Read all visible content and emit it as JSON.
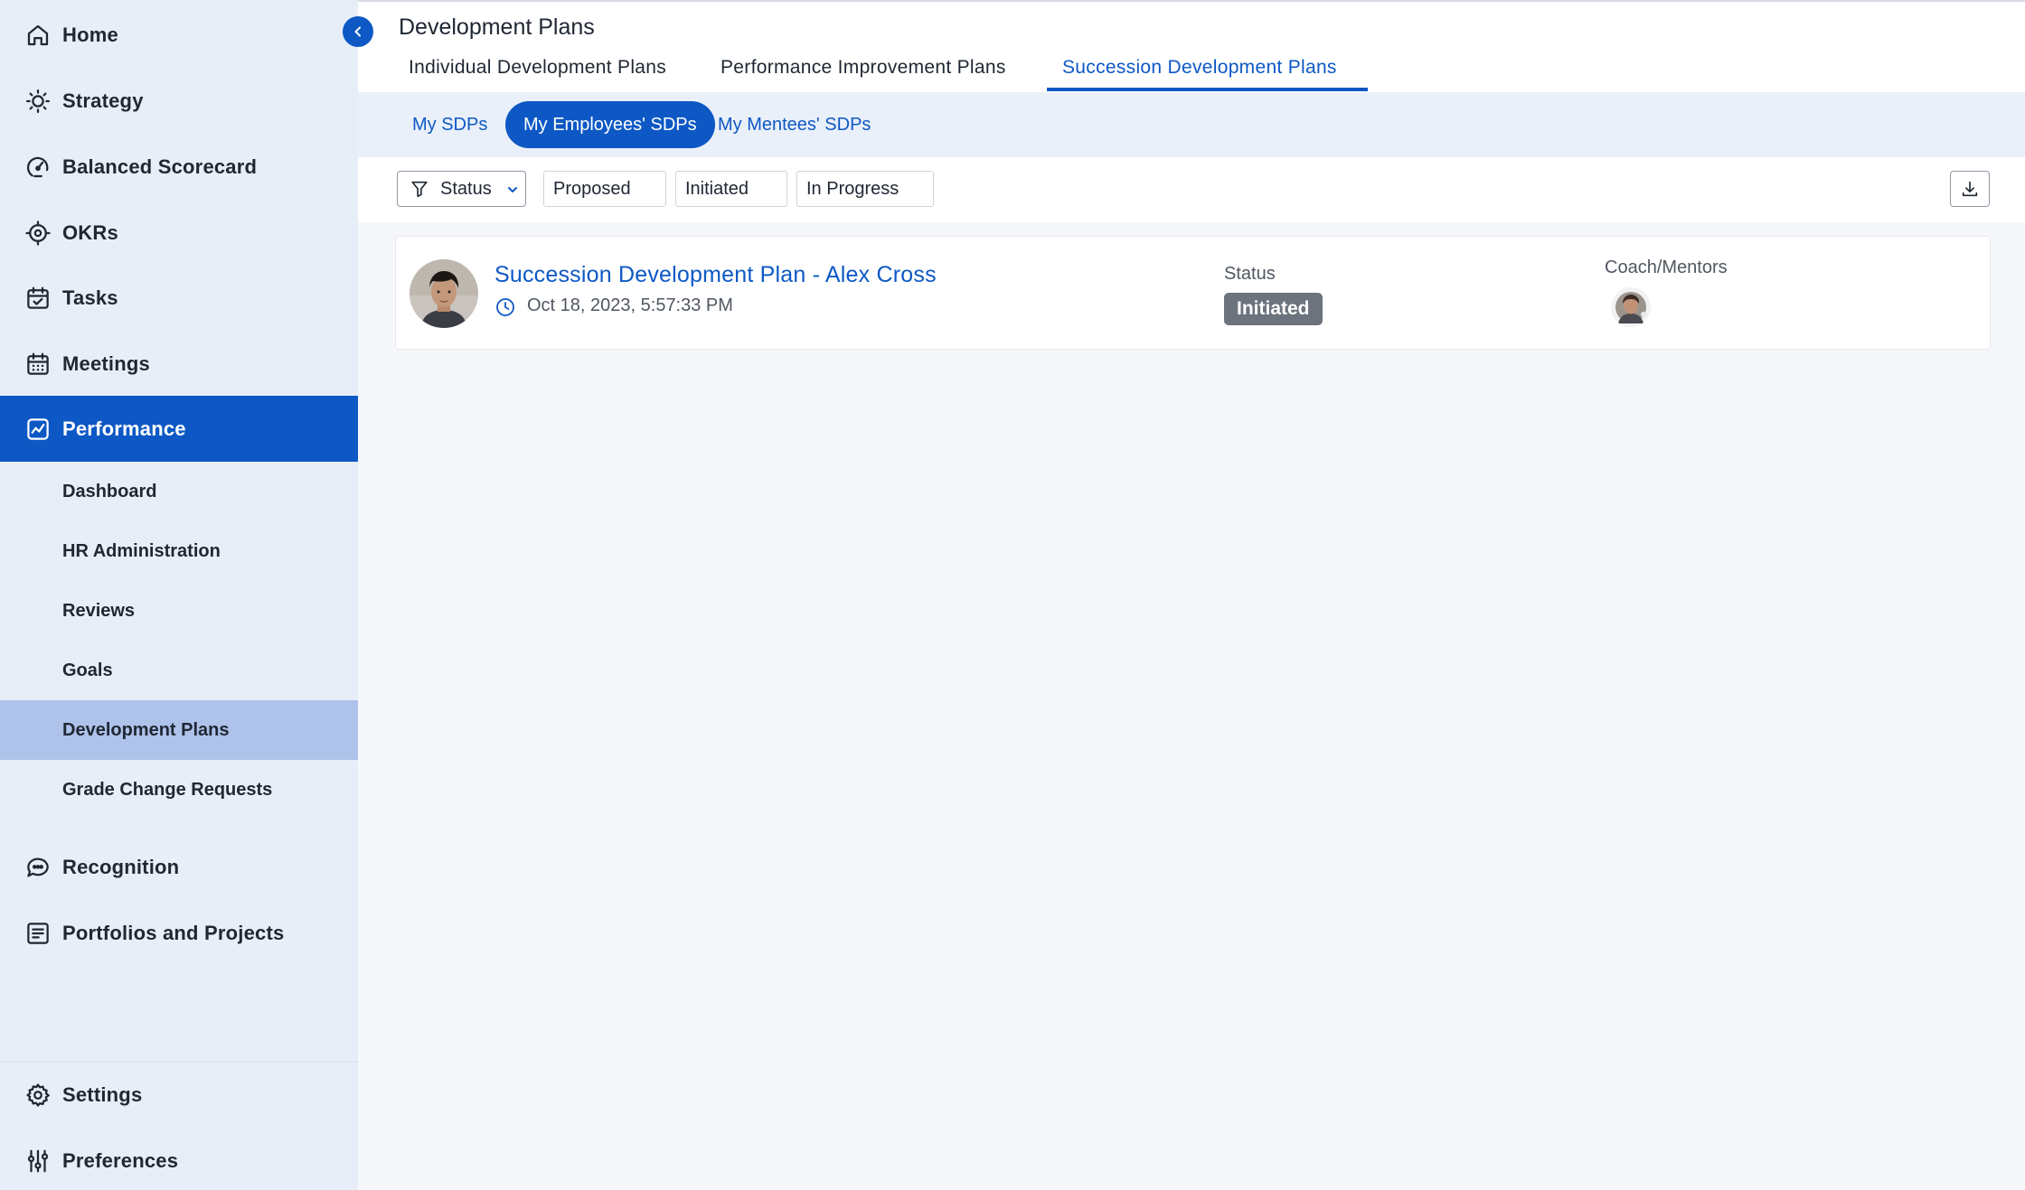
{
  "sidebar": {
    "items": [
      {
        "label": "Home",
        "icon": "home-icon"
      },
      {
        "label": "Strategy",
        "icon": "lightbulb-icon"
      },
      {
        "label": "Balanced Scorecard",
        "icon": "gauge-icon"
      },
      {
        "label": "OKRs",
        "icon": "target-icon"
      },
      {
        "label": "Tasks",
        "icon": "calendar-check-icon"
      },
      {
        "label": "Meetings",
        "icon": "calendar-grid-icon"
      },
      {
        "label": "Performance",
        "icon": "chart-line-icon",
        "active": true
      },
      {
        "label": "Recognition",
        "icon": "chat-icon"
      },
      {
        "label": "Portfolios and Projects",
        "icon": "document-list-icon"
      }
    ],
    "performance_sub": [
      {
        "label": "Dashboard"
      },
      {
        "label": "HR Administration"
      },
      {
        "label": "Reviews"
      },
      {
        "label": "Goals"
      },
      {
        "label": "Development Plans",
        "active": true
      },
      {
        "label": "Grade Change Requests"
      }
    ],
    "bottom": [
      {
        "label": "Settings",
        "icon": "gear-icon"
      },
      {
        "label": "Preferences",
        "icon": "sliders-icon"
      }
    ]
  },
  "header": {
    "title": "Development Plans",
    "tabs": [
      {
        "label": "Individual Development Plans"
      },
      {
        "label": "Performance Improvement Plans"
      },
      {
        "label": "Succession Development Plans",
        "active": true
      }
    ]
  },
  "subtabs": [
    {
      "label": "My SDPs"
    },
    {
      "label": "My Employees' SDPs",
      "active": true
    },
    {
      "label": "My Mentees' SDPs"
    }
  ],
  "filters": {
    "status_label": "Status",
    "chips": [
      "Proposed",
      "Initiated",
      "In Progress"
    ]
  },
  "plans": [
    {
      "title": "Succession Development Plan - Alex Cross",
      "timestamp": "Oct 18, 2023, 5:57:33 PM",
      "status_label": "Status",
      "status": "Initiated",
      "mentors_label": "Coach/Mentors"
    }
  ],
  "colors": {
    "primary": "#0d58c5",
    "sidebar_bg": "#e7eef8",
    "active_sub_bg": "#aec2ea",
    "badge_bg": "#6c737d"
  }
}
